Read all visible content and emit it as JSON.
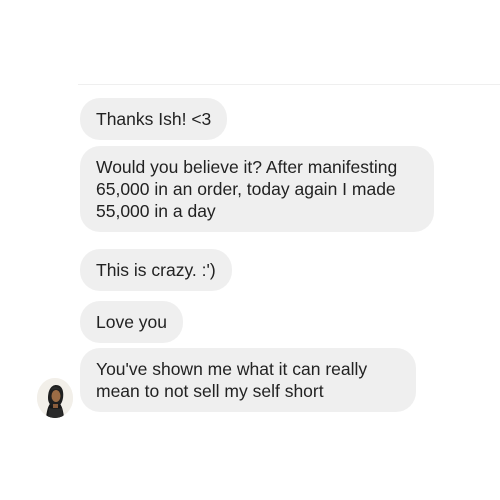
{
  "chat": {
    "messages": [
      {
        "text": "Thanks Ish! <3"
      },
      {
        "text": "Would you believe it? After manifesting\n65,000 in an order, today again I made\n55,000 in a day"
      },
      {
        "text": "This is crazy. :')"
      },
      {
        "text": "Love you"
      },
      {
        "text": "You've shown me what it can really\nmean to not sell my self short"
      }
    ]
  },
  "colors": {
    "background": "#ffffff",
    "bubble": "#efefef",
    "text": "#222222"
  }
}
